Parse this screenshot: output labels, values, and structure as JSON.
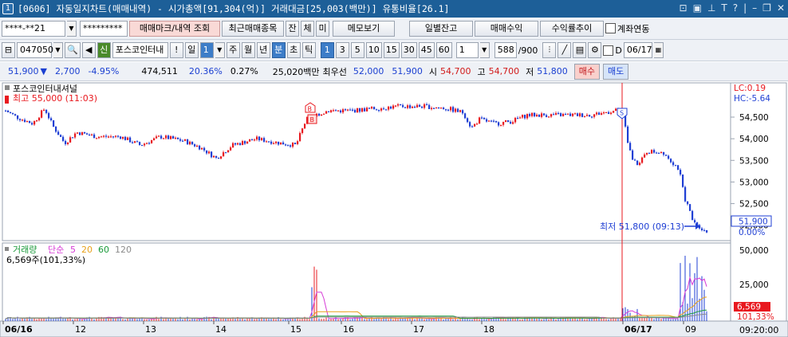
{
  "titlebar": {
    "window_no": "1",
    "title": "[0606] 자동일지차트(매매내역) - 시가총액[91,304(억)] 거래대금[25,003(백만)] 유통비율[26.1]"
  },
  "toolbar1": {
    "account_value": "****-**21",
    "password_value": "*********",
    "trade_mark_button": "매매마크/내역 조회",
    "recent_stocks_button": "최근매매종목",
    "jan_button": "잔",
    "che_button": "체",
    "mi_button": "미",
    "memo_button": "메모보기",
    "daily_balance_button": "일별잔고",
    "trade_profit_button": "매매수익",
    "return_trend_button": "수익률추이",
    "account_link_label": "계좌연동"
  },
  "toolbar2": {
    "stock_code": "047050",
    "credit_badge": "신",
    "stock_name": "포스코인터내",
    "exclaim": "!",
    "period_label": "일",
    "period_value": "1",
    "periods": [
      "주",
      "월",
      "년",
      "분",
      "초",
      "틱"
    ],
    "minute_options": [
      "1",
      "3",
      "5",
      "10",
      "15",
      "30",
      "45",
      "60"
    ],
    "custom_value": "1",
    "count_value": "588",
    "count_total": "/900",
    "d_label": "D",
    "date_value": "06/17"
  },
  "pricebar": {
    "price": "51,900",
    "arrow": "▼",
    "change": "2,700",
    "change_pct": "-4.95%",
    "volume": "474,511",
    "vol_pct": "20.36%",
    "ratio": "0.27%",
    "amount": "25,020백만",
    "best_label": "최우선",
    "best_bid": "52,000",
    "best_ask": "51,900",
    "open_label": "시",
    "open": "54,700",
    "high_label": "고",
    "high": "54,700",
    "low_label": "저",
    "low": "51,800",
    "buy_button": "매수",
    "sell_button": "매도"
  },
  "chart": {
    "stock_title": "포스코인터내셔널",
    "high_annotation": "최고 55,000 (11:03)",
    "low_annotation": "최저 51,800 (09:13)",
    "lc_label": "LC:0.19",
    "hc_label": "HC:-5.64",
    "price_axis": [
      "54,500",
      "54,000",
      "53,500",
      "53,000",
      "52,500",
      "52,000"
    ],
    "current_price_label": "51,900",
    "current_pct_label": "0.00%",
    "volume_legend": {
      "name": "거래량",
      "ma_label": "단순",
      "ma1": "5",
      "ma2": "20",
      "ma3": "60",
      "ma4": "120"
    },
    "volume_info": "6,569주(101,33%)",
    "volume_axis": [
      "50,000",
      "25,000"
    ],
    "volume_current": "6,569",
    "volume_pct": "101,33%",
    "x_labels": [
      "06/16",
      "12",
      "13",
      "14",
      "15",
      "16",
      "17",
      "18",
      "06/17",
      "09"
    ],
    "time_label": "09:20:00",
    "marker_buy": "B",
    "marker_sell": "S",
    "colors": {
      "up": "#e8191f",
      "down": "#1f3fd4",
      "ma5": "#d63ad6",
      "ma20": "#e8a11a",
      "ma60": "#1a9a3a",
      "ma120": "#8a8a8a",
      "split": "#e8191f"
    }
  },
  "chart_data": {
    "type": "candlestick",
    "x": [
      "06/16 09:00",
      "06/16 11:00",
      "06/16 13:00",
      "06/16 14:00",
      "06/16 15:00",
      "06/17 09:00",
      "06/17 09:13",
      "06/17 09:20"
    ],
    "close": [
      54700,
      54700,
      53900,
      53600,
      54600,
      53700,
      51800,
      51900
    ],
    "ylim": [
      51700,
      55200
    ],
    "volume_ylim": [
      0,
      55000
    ]
  }
}
